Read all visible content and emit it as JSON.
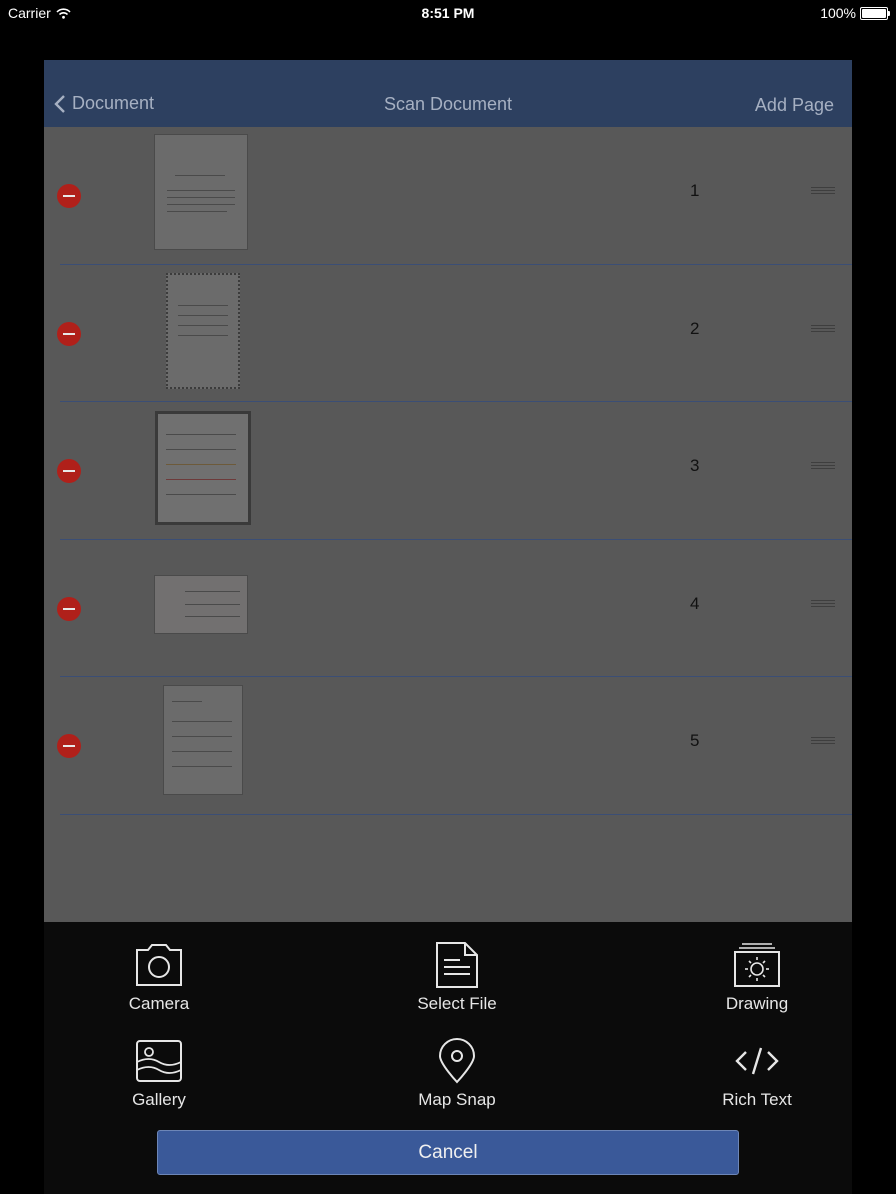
{
  "status_bar": {
    "carrier": "Carrier",
    "time": "8:51 PM",
    "battery": "100%"
  },
  "nav": {
    "back_label": "Document",
    "title": "Scan Document",
    "add_label": "Add Page"
  },
  "pages": [
    {
      "number": "1"
    },
    {
      "number": "2"
    },
    {
      "number": "3"
    },
    {
      "number": "4"
    },
    {
      "number": "5"
    }
  ],
  "actions": {
    "camera": "Camera",
    "select_file": "Select File",
    "drawing": "Drawing",
    "gallery": "Gallery",
    "map_snap": "Map Snap",
    "rich_text": "Rich Text"
  },
  "cancel_label": "Cancel",
  "colors": {
    "nav_bar": "#2d4060",
    "delete": "#b0201a",
    "cancel": "#3a5999",
    "separator": "#3b4e75"
  }
}
